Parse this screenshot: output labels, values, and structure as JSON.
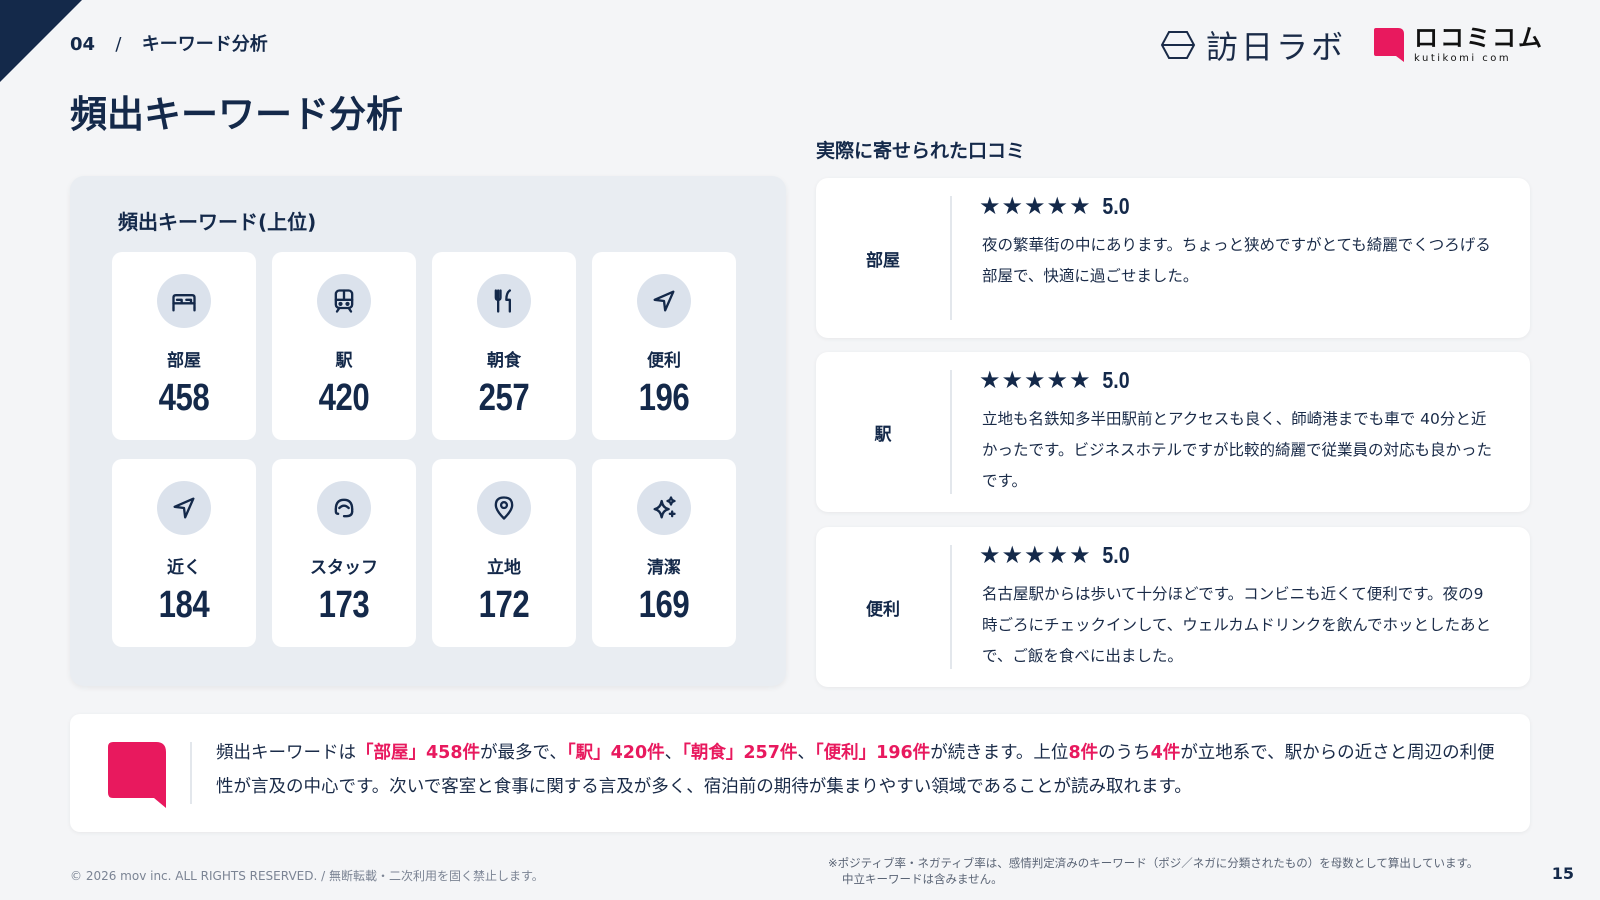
{
  "header": {
    "section_number": "04",
    "section_sep": "/",
    "section_name": "キーワード分析",
    "page_title": "頻出キーワード分析",
    "logo_houjin": "訪日ラボ",
    "logo_kuchikomi": "ロコミコム",
    "logo_kuchikomi_sub": "kutikomi com"
  },
  "keywords": {
    "title": "頻出キーワード(上位)",
    "items": [
      {
        "label": "部屋",
        "count": "458",
        "icon": "bed-icon"
      },
      {
        "label": "駅",
        "count": "420",
        "icon": "train-icon"
      },
      {
        "label": "朝食",
        "count": "257",
        "icon": "utensils-icon"
      },
      {
        "label": "便利",
        "count": "196",
        "icon": "navigation-icon"
      },
      {
        "label": "近く",
        "count": "184",
        "icon": "navigation-icon"
      },
      {
        "label": "スタッフ",
        "count": "173",
        "icon": "staff-icon"
      },
      {
        "label": "立地",
        "count": "172",
        "icon": "map-pin-icon"
      },
      {
        "label": "清潔",
        "count": "169",
        "icon": "sparkles-icon"
      }
    ]
  },
  "reviews": {
    "title": "実際に寄せられた口コミ",
    "items": [
      {
        "tag": "部屋",
        "stars": "★★★★★",
        "score": "5.0",
        "text": "夜の繁華街の中にあります。ちょっと狭めですがとても綺麗でくつろげる部屋で、快適に過ごせました。"
      },
      {
        "tag": "駅",
        "stars": "★★★★★",
        "score": "5.0",
        "text": "立地も名鉄知多半田駅前とアクセスも良く、師崎港までも車で 40分と近かったです。ビジネスホテルですが比較的綺麗で従業員の対応も良かったです。"
      },
      {
        "tag": "便利",
        "stars": "★★★★★",
        "score": "5.0",
        "text": "名古屋駅からは歩いて十分ほどです。コンビニも近くて便利です。夜の9時ごろにチェックインして、ウェルカムドリンクを飲んでホッとしたあとで、ご飯を食べに出ました。"
      }
    ]
  },
  "summary": {
    "t1": "頻出キーワードは",
    "h1": "「部屋」458件",
    "t2": "が最多で、",
    "h2": "「駅」420件",
    "t3": "、",
    "h3": "「朝食」257件",
    "t4": "、",
    "h4": "「便利」196件",
    "t5": "が続きます。上位",
    "h5": "8件",
    "t6": "のうち",
    "h6": "4件",
    "t7": "が立地系で、駅からの近さと周辺の利便性が言及の中心です。次いで客室と食事に関する言及が多く、宿泊前の期待が集まりやすい領域であることが読み取れます。"
  },
  "footer": {
    "copyright": "© 2026 mov inc. ALL RIGHTS RESERVED. / 無断転載・二次利用を固く禁止します。",
    "note_line1": "※ポジティブ率・ネガティブ率は、感情判定済みのキーワード（ポジ／ネガに分類されたもの）を母数として算出しています。",
    "note_line2": "中立キーワードは含みません。",
    "page_number": "15"
  },
  "colors": {
    "navy": "#14294a",
    "accent_pink": "#e8195e",
    "panel_bg": "#e9edf2",
    "icon_circle": "#dbe2ec"
  }
}
